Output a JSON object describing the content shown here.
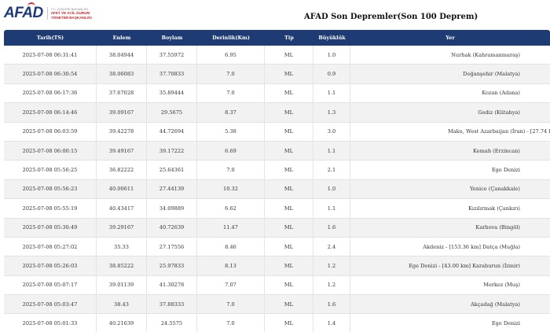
{
  "header": {
    "logo": {
      "mark": "AFAD",
      "line1": "T.C. İÇİŞLERİ BAKANLIĞI",
      "line2": "AFET VE ACİL DURUM",
      "line3": "YÖNETİMİ BAŞKANLIĞI"
    },
    "title": "AFAD Son Depremler(Son 100 Deprem)"
  },
  "table": {
    "columns": [
      "Tarih(TS)",
      "Enlem",
      "Boylam",
      "Derinlik(Km)",
      "Tip",
      "Büyüklük",
      "Yer"
    ],
    "rows": [
      [
        "2025-07-08 06:31:41",
        "38.04944",
        "37.55972",
        "6.95",
        "ML",
        "1.0",
        "Nurhak (Kahramanmaraş)"
      ],
      [
        "2025-07-08 06:30:54",
        "38.06083",
        "37.70833",
        "7.0",
        "ML",
        "0.9",
        "Doğanşehir (Malatya)"
      ],
      [
        "2025-07-08 06:17:36",
        "37.67028",
        "35.89444",
        "7.0",
        "ML",
        "1.1",
        "Kozan (Adana)"
      ],
      [
        "2025-07-08 06:14:46",
        "39.09167",
        "29.5675",
        "8.37",
        "ML",
        "1.3",
        "Gediz (Kütahya)"
      ],
      [
        "2025-07-08 06:03:59",
        "39.42278",
        "44.72694",
        "5.38",
        "ML",
        "3.0",
        "Maku, West Azarbaijan (İran) - [27.74 km] Doğubayazıt (Ağrı)"
      ],
      [
        "2025-07-08 06:00:15",
        "39.49167",
        "39.17222",
        "6.69",
        "ML",
        "1.1",
        "Kemah (Erzincan)"
      ],
      [
        "2025-07-08 05:56:25",
        "36.82222",
        "25.64361",
        "7.0",
        "ML",
        "2.1",
        "Ege Denizi"
      ],
      [
        "2025-07-08 05:56:23",
        "40.00611",
        "27.44139",
        "10.32",
        "ML",
        "1.0",
        "Yenice (Çanakkale)"
      ],
      [
        "2025-07-08 05:55:19",
        "40.43417",
        "34.09889",
        "6.62",
        "ML",
        "1.1",
        "Kızılırmak (Çankırı)"
      ],
      [
        "2025-07-08 05:30:49",
        "39.29167",
        "40.72639",
        "11.47",
        "ML",
        "1.6",
        "Karlıova (Bingöl)"
      ],
      [
        "2025-07-08 05:27:02",
        "35.33",
        "27.17556",
        "8.46",
        "ML",
        "2.4",
        "Akdeniz - [153.36 km] Datça (Muğla)"
      ],
      [
        "2025-07-08 05:26:03",
        "38.85222",
        "25.97833",
        "8.13",
        "ML",
        "1.2",
        "Ege Denizi - [43.00 km] Karaburun (İzmir)"
      ],
      [
        "2025-07-08 05:07:17",
        "39.01139",
        "41.30278",
        "7.07",
        "ML",
        "1.2",
        "Merkez (Muş)"
      ],
      [
        "2025-07-08 05:03:47",
        "38.43",
        "37.88333",
        "7.0",
        "ML",
        "1.6",
        "Akçadağ (Malatya)"
      ],
      [
        "2025-07-08 05:01:33",
        "40.21639",
        "24.5575",
        "7.0",
        "ML",
        "1.4",
        "Ege Denizi"
      ]
    ]
  }
}
